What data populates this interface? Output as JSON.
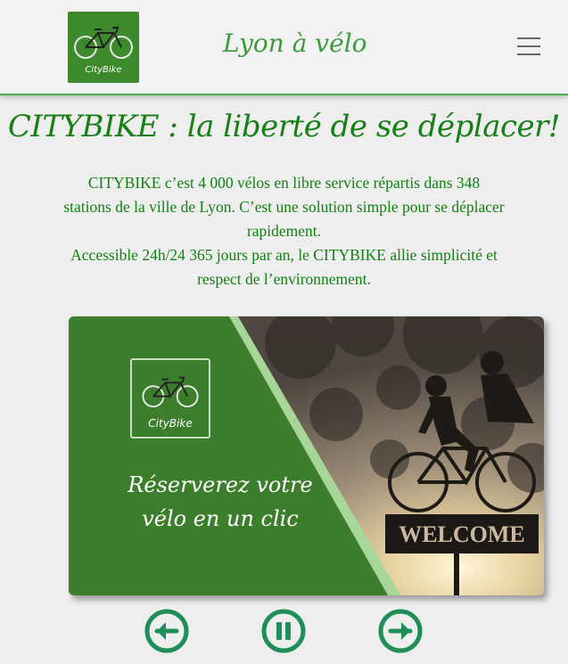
{
  "header": {
    "logo_text": "CityBike",
    "site_title": "Lyon à vélo",
    "menu_icon": "hamburger-menu-icon"
  },
  "main": {
    "headline": "CITYBIKE : la liberté de se déplacer!",
    "intro_lines": [
      "CITYBIKE c’est 4 000 vélos en libre service répartis dans 348 stations de la ville de Lyon. C’est une solution simple pour se déplacer rapidement.",
      "Accessible 24h/24 365 jours par an, le CITYBIKE allie simplicité et respect de l’environnement."
    ]
  },
  "carousel": {
    "slide_logo_text": "CityBike",
    "caption_line1": "Réserverez votre",
    "caption_line2": "vélo en un clic",
    "photo_sign_text": "WELCOME",
    "controls": {
      "prev_icon": "arrow-left-circle-icon",
      "pause_icon": "pause-circle-icon",
      "next_icon": "arrow-right-circle-icon"
    }
  },
  "colors": {
    "brand_green": "#3c7e2c",
    "title_green": "#167f16",
    "accent_green": "#1f8f5a",
    "header_line": "#4cae52"
  }
}
